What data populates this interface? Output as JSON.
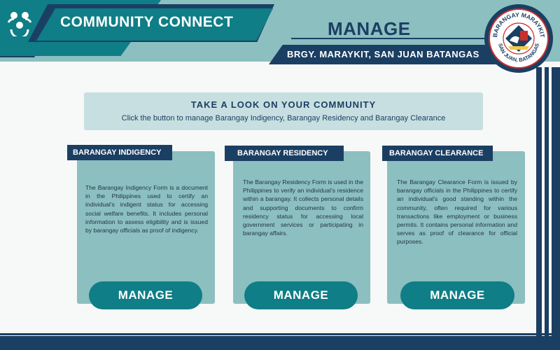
{
  "header": {
    "app_title": "COMMUNITY CONNECT",
    "page_heading": "MANAGE",
    "location": "BRGY. MARAYKIT, SAN JUAN BATANGAS",
    "logo_icon": "community-people-icon",
    "seal": {
      "top_text": "BARANGAY MARAYKIT",
      "bottom_text": "SAN JUAN, BATANGAS"
    }
  },
  "intro": {
    "title": "TAKE A LOOK ON YOUR COMMUNITY",
    "subtitle": "Click the button to manage Barangay Indigency, Barangay Residency and Barangay Clearance"
  },
  "cards": [
    {
      "title": "BARANGAY INDIGENCY",
      "description": "The Barangay Indigency Form is a document in the Philippines used to certify an individual's indigent status for accessing social welfare benefits. It includes personal information to assess eligibility and is issued by barangay officials as proof of indigency.",
      "button": "MANAGE"
    },
    {
      "title": "BARANGAY RESIDENCY",
      "description": "The Barangay Residency Form is used in the Philippines to verify an individual's residence within a barangay. It collects personal details and supporting documents to confirm residency status for accessing local government services or participating in barangay affairs.",
      "button": "MANAGE"
    },
    {
      "title": "BARANGAY CLEARANCE",
      "description": "The Barangay Clearance Form is issued by barangay officials in the Philippines to certify an individual's good standing within the community, often required for various transactions like employment or business permits. It contains personal information and serves as proof of clearance for official purposes.",
      "button": "MANAGE"
    }
  ],
  "colors": {
    "navy": "#1b3f63",
    "teal": "#0f7e86",
    "light_teal": "#8cbfc0",
    "pale_teal": "#c7dfe0"
  }
}
